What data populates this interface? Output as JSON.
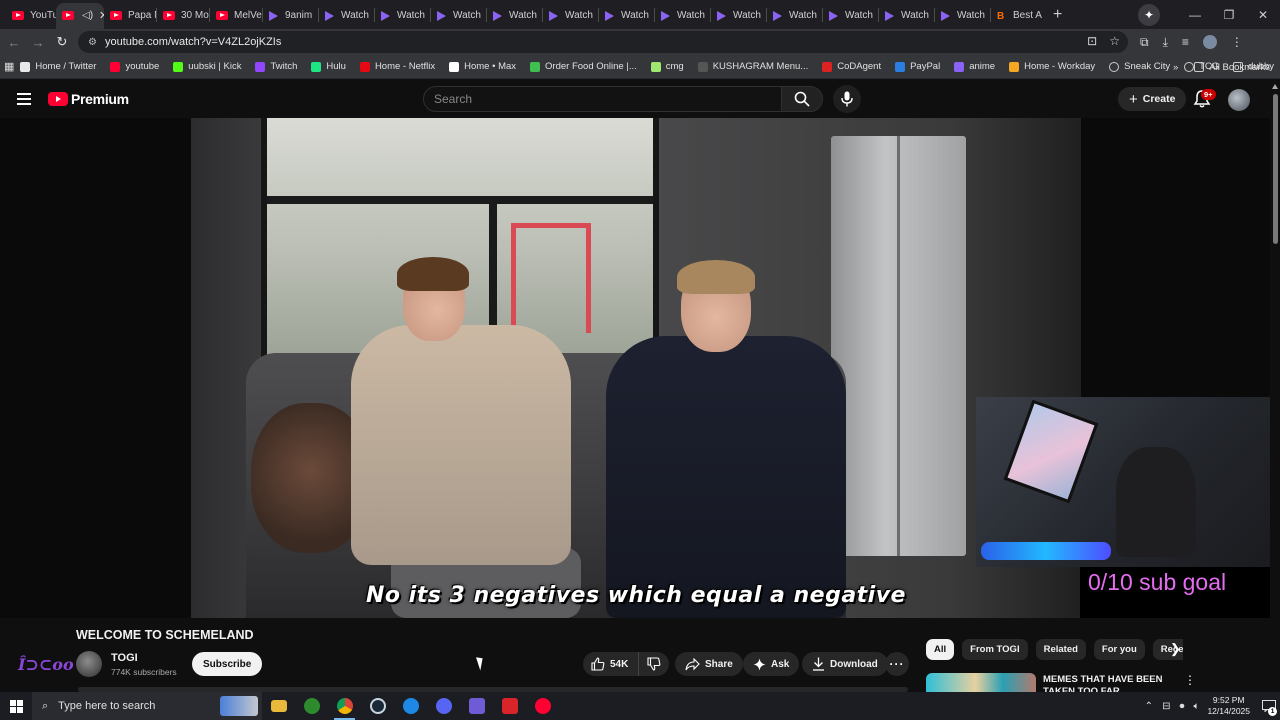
{
  "browser": {
    "tabs": [
      {
        "label": "YouTu",
        "icon": "youtube-favicon",
        "active": false
      },
      {
        "label": "",
        "icon": "youtube-favicon",
        "active": true,
        "audio": true
      },
      {
        "label": "Papa M",
        "icon": "youtube-favicon",
        "active": false
      },
      {
        "label": "30 Mo",
        "icon": "youtube-favicon",
        "active": false
      },
      {
        "label": "MelVe",
        "icon": "youtube-favicon",
        "active": false
      },
      {
        "label": "9anim",
        "icon": "purple-play-favicon",
        "active": false
      },
      {
        "label": "Watch",
        "icon": "purple-play-favicon",
        "active": false
      },
      {
        "label": "Watch",
        "icon": "purple-play-favicon",
        "active": false
      },
      {
        "label": "Watch",
        "icon": "purple-play-favicon",
        "active": false
      },
      {
        "label": "Watch",
        "icon": "purple-play-favicon",
        "active": false
      },
      {
        "label": "Watch",
        "icon": "purple-play-favicon",
        "active": false
      },
      {
        "label": "Watch",
        "icon": "purple-play-favicon",
        "active": false
      },
      {
        "label": "Watch",
        "icon": "purple-play-favicon",
        "active": false
      },
      {
        "label": "Watch",
        "icon": "purple-play-favicon",
        "active": false
      },
      {
        "label": "Watch",
        "icon": "purple-play-favicon",
        "active": false
      },
      {
        "label": "Watch",
        "icon": "purple-play-favicon",
        "active": false
      },
      {
        "label": "Watch",
        "icon": "purple-play-favicon",
        "active": false
      },
      {
        "label": "Watch",
        "icon": "purple-play-favicon",
        "active": false
      },
      {
        "label": "Best A",
        "icon": "orange-b-favicon",
        "active": false
      }
    ],
    "url": "youtube.com/watch?v=V4ZL2ojKZIs",
    "bookmarks": [
      {
        "label": "Home / Twitter",
        "color": "#e7e9ea",
        "icon": "x-icon"
      },
      {
        "label": "youtube",
        "color": "#ff0033",
        "icon": "youtube-icon"
      },
      {
        "label": "uubski | Kick",
        "color": "#53fc18",
        "icon": "kick-icon"
      },
      {
        "label": "Twitch",
        "color": "#9146ff",
        "icon": "twitch-icon"
      },
      {
        "label": "Hulu",
        "color": "#1ce783",
        "icon": "hulu-icon"
      },
      {
        "label": "Home - Netflix",
        "color": "#e50914",
        "icon": "netflix-icon"
      },
      {
        "label": "Home • Max",
        "color": "#ffffff",
        "icon": "max-icon"
      },
      {
        "label": "Order Food Online |...",
        "color": "#3fbf4f",
        "icon": "food-icon"
      },
      {
        "label": "cmg",
        "color": "#9fe870",
        "icon": "cmg-icon"
      },
      {
        "label": "KUSHAGRAM Menu...",
        "color": "#555555",
        "icon": "menu-icon"
      },
      {
        "label": "CoDAgent",
        "color": "#d22",
        "icon": "codagent-icon"
      },
      {
        "label": "PayPal",
        "color": "#2a7de1",
        "icon": "paypal-icon"
      },
      {
        "label": "anime",
        "color": "#8a63f5",
        "icon": "anime-icon"
      },
      {
        "label": "Home - Workday",
        "color": "#f5a623",
        "icon": "workday-icon"
      },
      {
        "label": "Sneak City",
        "color": "#cccccc",
        "icon": "globe-icon"
      },
      {
        "label": "TCG",
        "color": "#cccccc",
        "icon": "globe-icon"
      },
      {
        "label": "dubby",
        "color": "#cccccc",
        "icon": "folder-icon"
      }
    ],
    "all_bookmarks_label": "All Bookmarks"
  },
  "youtube": {
    "logo_text": "Premium",
    "search_placeholder": "Search",
    "create_label": "Create",
    "notification_count": "9+",
    "video": {
      "subtitle": "No its 3 negatives which equal a negative",
      "overlay_sub_goal": "0/10 sub goal"
    },
    "title": "WELCOME TO SCHEMELAND",
    "channel": {
      "name": "TOGI",
      "subscribers": "774K subscribers",
      "subscribe_label": "Subscribe"
    },
    "actions": {
      "likes": "54K",
      "share": "Share",
      "ask": "Ask",
      "download": "Download"
    },
    "chips": [
      "All",
      "From TOGI",
      "Related",
      "For you",
      "Rece"
    ],
    "recommendation": {
      "title": "MEMES THAT HAVE BEEN TAKEN TOO FAR"
    }
  },
  "taskbar": {
    "search_placeholder": "Type here to search",
    "time": "9:52 PM",
    "date": "12/14/2025",
    "notification_count": "1"
  }
}
